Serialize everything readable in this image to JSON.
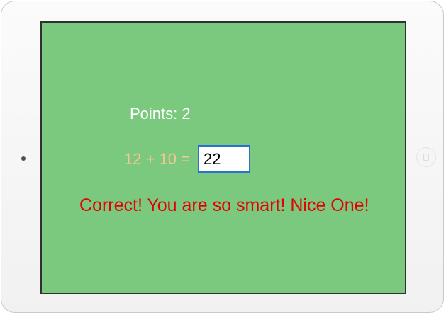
{
  "game": {
    "points_label": "Points: 2",
    "equation": "12 + 10 =",
    "answer_value": "22",
    "feedback": "Correct! You are so smart! Nice One!"
  },
  "colors": {
    "screen_background": "#7bc97e",
    "points_text": "#ffffff",
    "equation_text": "#f4c690",
    "feedback_text": "#e30000",
    "input_border": "#2a6fd4"
  },
  "device": {
    "camera_icon": "camera-dot",
    "home_button_icon": "home-button"
  }
}
